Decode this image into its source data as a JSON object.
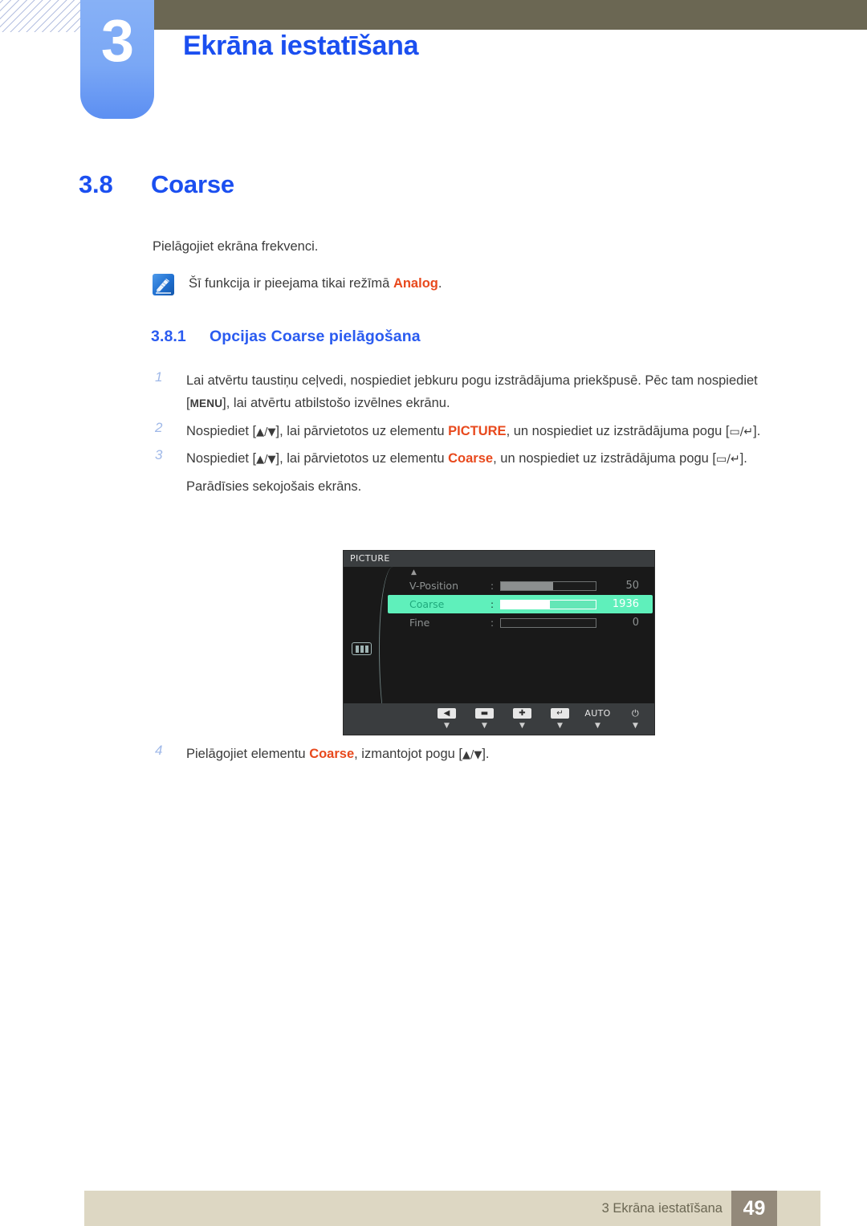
{
  "header": {
    "chapter_number": "3",
    "chapter_title": "Ekrāna iestatīšana"
  },
  "section": {
    "number": "3.8",
    "title": "Coarse"
  },
  "intro_text": "Pielāgojiet ekrāna frekvenci.",
  "note": {
    "icon": "note-pen-icon",
    "text_before": "Šī funkcija ir pieejama tikai režīmā ",
    "highlight": "Analog",
    "text_after": "."
  },
  "subsection": {
    "number": "3.8.1",
    "title": "Opcijas Coarse pielāgošana"
  },
  "steps": [
    {
      "num": "1",
      "part1": "Lai atvērtu taustiņu ceļvedi, nospiediet jebkuru pogu izstrādājuma priekšpusē. Pēc tam nospiediet [",
      "key": "MENU",
      "part2": "], lai atvērtu atbilstošo izvēlnes ekrānu."
    },
    {
      "num": "2",
      "part1": "Nospiediet [",
      "keys": "▲/▼",
      "part2": "], lai pārvietotos uz elementu ",
      "highlight": "PICTURE",
      "part3": ", un nospiediet uz izstrādājuma pogu [",
      "keys2": "▭/↵",
      "part4": "]."
    },
    {
      "num": "3",
      "part1": "Nospiediet [",
      "keys": "▲/▼",
      "part2": "], lai pārvietotos uz elementu ",
      "highlight": "Coarse",
      "part3": ", un nospiediet uz izstrādājuma pogu [",
      "keys2": "▭/↵",
      "part4": "].",
      "follow_up": "Parādīsies sekojošais ekrāns."
    },
    {
      "num": "4",
      "part1": "Pielāgojiet elementu ",
      "highlight": "Coarse",
      "part2": ", izmantojot pogu [",
      "keys": "▲/▼",
      "part3": "]."
    }
  ],
  "osd": {
    "title": "PICTURE",
    "scroll_up_indicator": "▲",
    "side_icon": "picture-bars-icon",
    "rows": [
      {
        "label": "V-Position",
        "colon": ":",
        "value": "50",
        "fill_percent": 55,
        "selected": false
      },
      {
        "label": "Coarse",
        "colon": ":",
        "value": "1936",
        "fill_percent": 52,
        "selected": true
      },
      {
        "label": "Fine",
        "colon": ":",
        "value": "0",
        "fill_percent": 0,
        "selected": false
      }
    ],
    "buttons": [
      {
        "name": "back-button",
        "glyph": "◀",
        "type": "box",
        "sub": "▼"
      },
      {
        "name": "minus-button",
        "glyph": "▬",
        "type": "box",
        "sub": "▼"
      },
      {
        "name": "plus-button",
        "glyph": "✚",
        "type": "box",
        "sub": "▼"
      },
      {
        "name": "enter-button",
        "glyph": "↵",
        "type": "box",
        "sub": "▼"
      },
      {
        "name": "auto-button",
        "glyph": "AUTO",
        "type": "text",
        "sub": "▼"
      },
      {
        "name": "power-button",
        "glyph": "⏻",
        "type": "text",
        "sub": "▼"
      }
    ]
  },
  "footer": {
    "text": "3 Ekrāna iestatīšana",
    "page_number": "49"
  },
  "colors": {
    "accent_blue": "#1b4ff0",
    "header_olive": "#6b6753",
    "highlight_orange": "#e8491d",
    "osd_green": "#5ff0bb",
    "footer_beige": "#ddd7c3",
    "footer_page_brown": "#93897a"
  }
}
